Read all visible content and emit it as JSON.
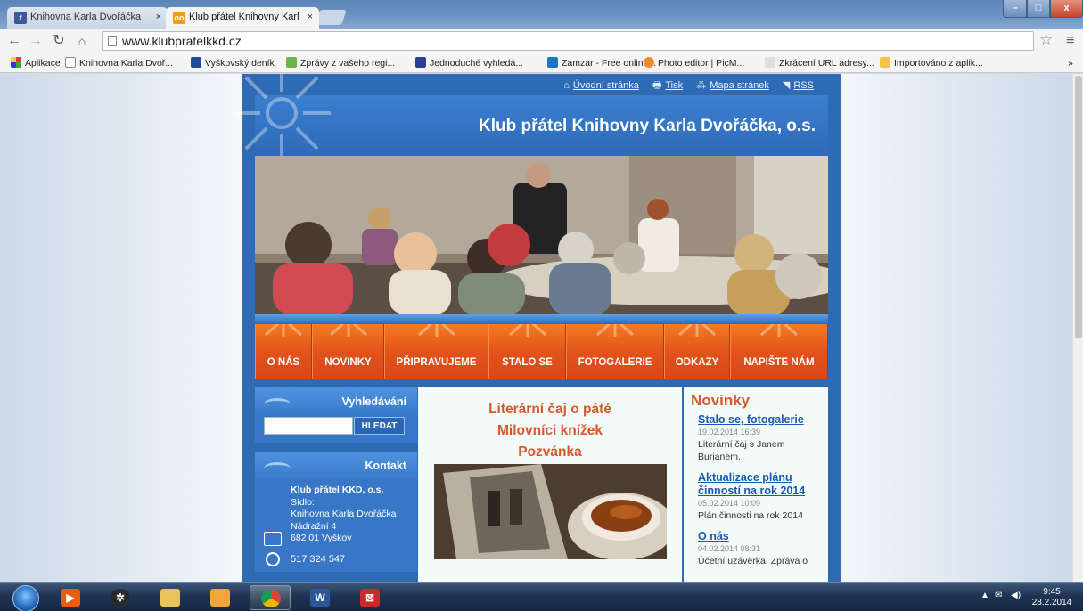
{
  "browser": {
    "tabs": [
      {
        "label": "Knihovna Karla Dvořáčka",
        "active": false
      },
      {
        "label": "Klub přátel Knihovny Karl",
        "active": true
      }
    ],
    "close_glyph": "×",
    "url": "www.klubpratelkkd.cz",
    "window_controls": {
      "minimize": "–",
      "maximize": "□",
      "close": "x"
    }
  },
  "bookmarks": [
    {
      "label": "Aplikace",
      "icon": "apps-icon"
    },
    {
      "label": "Knihovna Karla Dvoř...",
      "icon": "page-icon"
    },
    {
      "label": "Vyškovský deník",
      "icon": "vyskovsky-denik-icon"
    },
    {
      "label": "Zprávy z vašeho regi...",
      "icon": "news-icon"
    },
    {
      "label": "Jednoduché vyhledá...",
      "icon": "search-site-icon"
    },
    {
      "label": "Zamzar - Free online...",
      "icon": "zamzar-icon"
    },
    {
      "label": "Photo editor | PicM...",
      "icon": "picmonkey-icon"
    },
    {
      "label": "Zkrácení URL adresy...",
      "icon": "url-shortener-icon"
    },
    {
      "label": "Importováno z aplik...",
      "icon": "folder-icon"
    }
  ],
  "bookmarks_more": "»",
  "site": {
    "toplinks": [
      {
        "label": "Úvodní stránka",
        "icon": "⌂"
      },
      {
        "label": "Tisk",
        "icon": "🖶"
      },
      {
        "label": "Mapa stránek",
        "icon": "⁂"
      },
      {
        "label": "RSS",
        "icon": "◥"
      }
    ],
    "title": "Klub přátel Knihovny Karla Dvořáčka, o.s.",
    "nav": [
      "O NÁS",
      "NOVINKY",
      "PŘIPRAVUJEME",
      "STALO SE",
      "FOTOGALERIE",
      "ODKAZY",
      "NAPIŠTE NÁM"
    ],
    "search": {
      "heading": "Vyhledávání",
      "button": "HLEDAT",
      "placeholder": ""
    },
    "contact": {
      "heading": "Kontakt",
      "name": "Klub přátel KKD, o.s.",
      "seat_label": "Sídlo:",
      "address_lines": [
        "Knihovna Karla Dvořáčka",
        "Nádražní 4",
        "682 01 Vyškov"
      ],
      "phone": "517 324 547"
    },
    "article": {
      "lines": [
        "Literární čaj o páté",
        "Milovníci knížek",
        "Pozvánka"
      ]
    },
    "news": {
      "heading": "Novinky",
      "items": [
        {
          "title": "Stalo se, fotogalerie",
          "date": "19.02.2014 16:39",
          "text": "Literární čaj s Janem Burianem."
        },
        {
          "title": "Aktualizace plánu činností na rok 2014",
          "date": "05.02.2014 10:09",
          "text": "Plán činnosti na rok 2014"
        },
        {
          "title": "O nás",
          "date": "04.02.2014 08:31",
          "text": "Účetní uzávěrka, Zpráva o"
        }
      ]
    }
  },
  "taskbar": {
    "apps": [
      "media-player-icon",
      "settings-icon",
      "file-explorer-icon",
      "photo-viewer-icon",
      "chrome-icon",
      "word-icon",
      "pdf-icon"
    ],
    "time": "9:45",
    "date": "28.2.2014"
  },
  "colors": {
    "site_blue": "#2f6bb5",
    "nav_orange": "#e85a16",
    "accent_title": "#d8582c",
    "link_blue": "#1a59b0"
  }
}
